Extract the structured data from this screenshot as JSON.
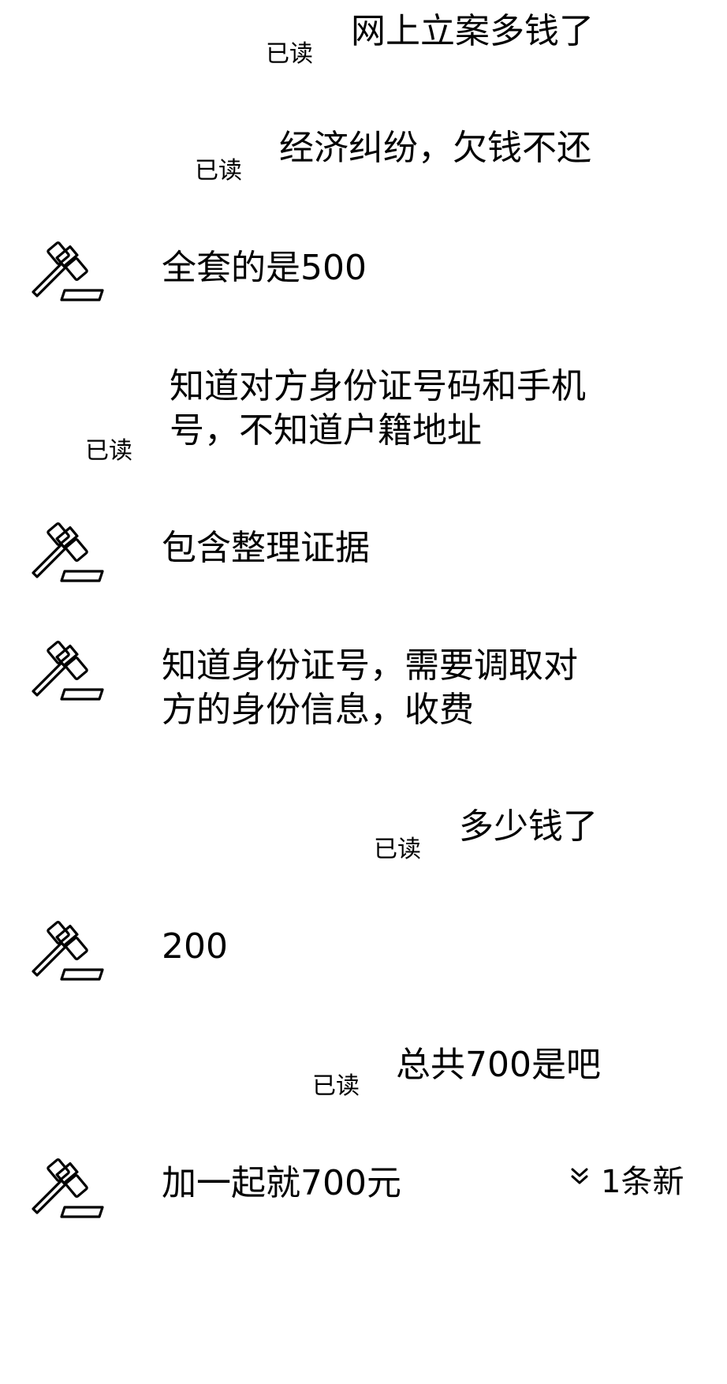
{
  "messages": [
    {
      "from": "me",
      "text": "网上立案多钱了",
      "status": "已读"
    },
    {
      "from": "me",
      "text": "经济纠纷，欠钱不还",
      "status": "已读"
    },
    {
      "from": "lawyer",
      "text": "全套的是500",
      "avatar_icon": "gavel-icon"
    },
    {
      "from": "me",
      "text": "知道对方身份证号码和手机号，不知道户籍地址",
      "status": "已读"
    },
    {
      "from": "lawyer",
      "text": "包含整理证据",
      "avatar_icon": "gavel-icon"
    },
    {
      "from": "lawyer",
      "text": "知道身份证号，需要调取对方的身份信息，收费",
      "avatar_icon": "gavel-icon"
    },
    {
      "from": "me",
      "text": "多少钱了",
      "status": "已读"
    },
    {
      "from": "lawyer",
      "text": "200",
      "avatar_icon": "gavel-icon"
    },
    {
      "from": "me",
      "text": "总共700是吧",
      "status": "已读"
    },
    {
      "from": "lawyer",
      "text": "加一起就700元",
      "avatar_icon": "gavel-icon"
    }
  ],
  "new_messages_indicator": {
    "icon": "double-chevron-down-icon",
    "label": "1条新"
  }
}
